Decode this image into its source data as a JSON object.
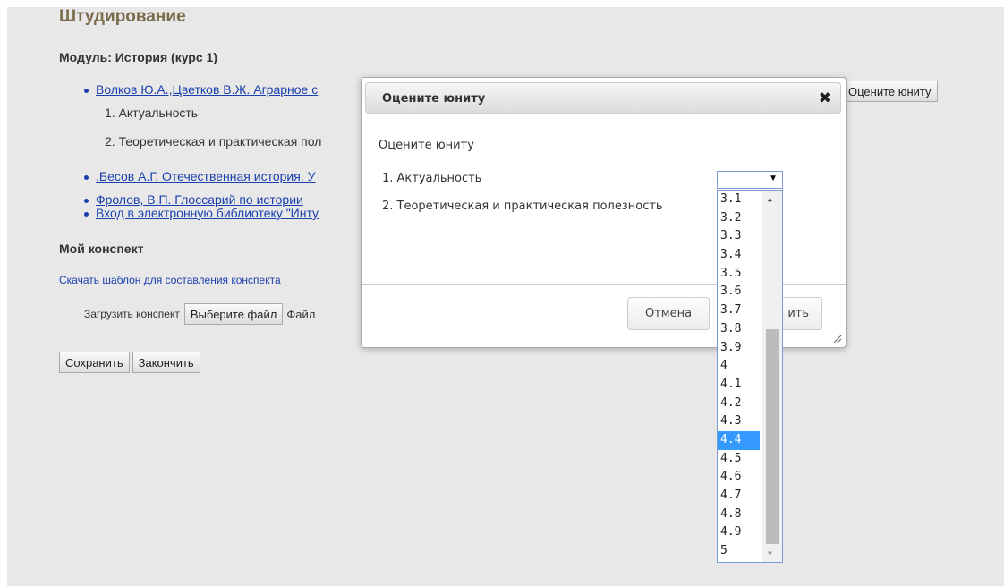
{
  "page_title": "Штудирование",
  "module_label": "Модуль: История (курс 1)",
  "links": {
    "item1": "Волков Ю.А.,Цветков В.Ж. Аграрное с",
    "item2": ".Бесов А.Г. Отечественная история. У",
    "item3": "Фролов, В.П. Глоссарий по истории",
    "item4": "Вход в электронную библиотеку \"Инту"
  },
  "sub_items": [
    "1. Актуальность",
    "2. Теоретическая и практическая пол"
  ],
  "rate_button_bg": "Оцените юниту",
  "konspekt_heading": "Мой конспект",
  "download_link": "Скачать шаблон для составления конспекта",
  "upload_label": "Загрузить конспект",
  "choose_file_button": "Выберите файл",
  "file_status": "Файл",
  "save_button": "Сохранить",
  "finish_button": "Закончить",
  "dialog": {
    "title": "Оцените юниту",
    "close_icon": "close-icon",
    "subtitle": "Оцените юниту",
    "questions": [
      "1. Актуальность",
      "2. Теоретическая и практическая полезность"
    ],
    "cancel_button": "Отмена",
    "submit_button_partial": "ить",
    "select_value": "",
    "options": [
      "3.1",
      "3.2",
      "3.3",
      "3.4",
      "3.5",
      "3.6",
      "3.7",
      "3.8",
      "3.9",
      "4",
      "4.1",
      "4.2",
      "4.3",
      "4.4",
      "4.5",
      "4.6",
      "4.7",
      "4.8",
      "4.9",
      "5"
    ],
    "selected_option": "4.4"
  },
  "colors": {
    "link": "#1a3faf",
    "title": "#7a6b4a",
    "selection": "#3399ff"
  }
}
